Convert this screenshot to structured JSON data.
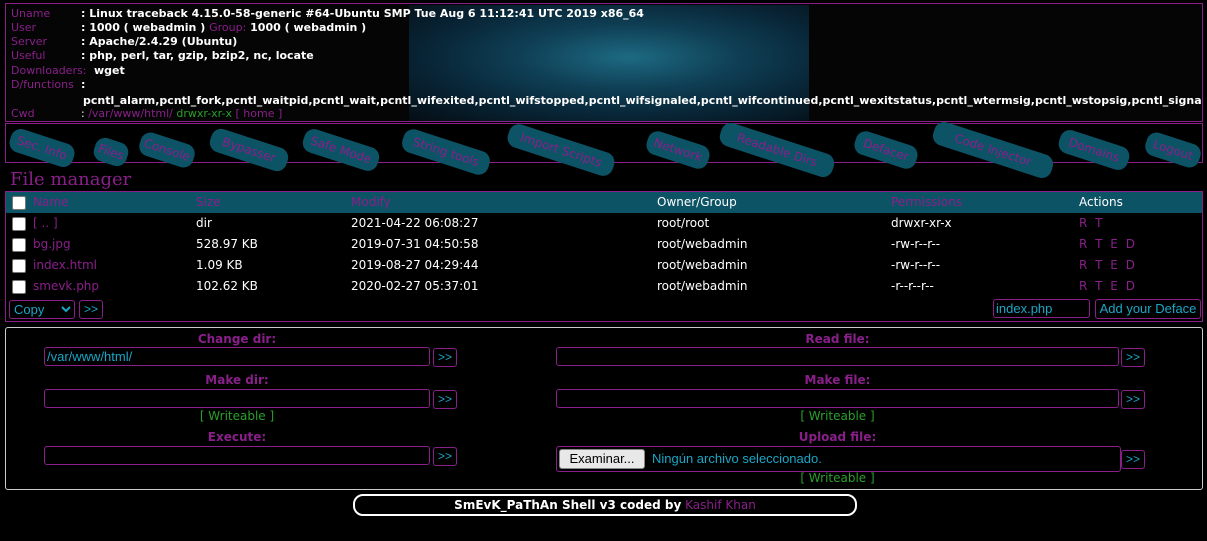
{
  "info": {
    "uname_label": "Uname",
    "uname_value": ": Linux traceback 4.15.0-58-generic #64-Ubuntu SMP Tue Aug 6 11:12:41 UTC 2019 x86_64",
    "user_label": "User",
    "user_value": ": 1000 ( webadmin )",
    "group_label": "Group:",
    "group_value": "1000 ( webadmin )",
    "server_label": "Server",
    "server_value": ": Apache/2.4.29 (Ubuntu)",
    "useful_label": "Useful",
    "useful_value": ": php, perl, tar, gzip, bzip2, nc, locate",
    "downloaders_label": "Downloaders:",
    "downloaders_value": "wget",
    "dfunctions_label": "D/functions",
    "dfunctions_colon": ":",
    "dfunctions_value": "pcntl_alarm,pcntl_fork,pcntl_waitpid,pcntl_wait,pcntl_wifexited,pcntl_wifstopped,pcntl_wifsignaled,pcntl_wifcontinued,pcntl_wexitstatus,pcntl_wtermsig,pcntl_wstopsig,pcntl_signal,pcntl_signal_get_h",
    "cwd_label": "Cwd",
    "cwd_colon": ":",
    "cwd_path": "/var/www/html/",
    "cwd_perms": "drwxr-xr-x",
    "cwd_home": "[ home ]"
  },
  "nav": [
    "Sec. Info",
    "Files",
    "Console",
    "Bypasser",
    "Safe Mode",
    "String tools",
    "Import Scripts",
    "Network",
    "Readable Dirs",
    "Defacer",
    "Code Injector",
    "Domains",
    "Logout"
  ],
  "file_manager": {
    "title": "File manager",
    "headers": {
      "name": "Name",
      "size": "Size",
      "modify": "Modify",
      "owner": "Owner/Group",
      "perms": "Permissions",
      "actions": "Actions"
    },
    "rows": [
      {
        "name": "[ .. ]",
        "size": "dir",
        "modify": "2021-04-22 06:08:27",
        "owner": "root/root",
        "perms": "drwxr-xr-x",
        "actions": "R T"
      },
      {
        "name": "bg.jpg",
        "size": "528.97 KB",
        "modify": "2019-07-31 04:50:58",
        "owner": "root/webadmin",
        "perms": "-rw-r--r--",
        "actions": "R T E D"
      },
      {
        "name": "index.html",
        "size": "1.09 KB",
        "modify": "2019-08-27 04:29:44",
        "owner": "root/webadmin",
        "perms": "-rw-r--r--",
        "actions": "R T E D"
      },
      {
        "name": "smevk.php",
        "size": "102.62 KB",
        "modify": "2020-02-27 05:37:01",
        "owner": "root/webadmin",
        "perms": "-r--r--r--",
        "actions": "R T E D"
      }
    ],
    "copy_select": "Copy",
    "go": ">>",
    "deface_file": "index.php",
    "deface_button": "Add your Deface"
  },
  "tools": {
    "change_dir_label": "Change dir:",
    "change_dir_value": "/var/www/html/",
    "make_dir_label": "Make dir:",
    "make_dir_status": "[ Writeable ]",
    "execute_label": "Execute:",
    "read_file_label": "Read file:",
    "make_file_label": "Make file:",
    "make_file_status": "[ Writeable ]",
    "upload_label": "Upload file:",
    "upload_button": "Examinar...",
    "upload_status_text": "Ningún archivo seleccionado.",
    "upload_status": "[ Writeable ]",
    "go": ">>"
  },
  "footer": {
    "text": "SmEvK_PaThAn Shell v3 coded by",
    "author": "Kashif Khan"
  },
  "colors": {
    "accent": "#8a1f8a",
    "teal": "#0d5366",
    "ok": "#2aa02a",
    "input_text": "#1aa6c6"
  }
}
